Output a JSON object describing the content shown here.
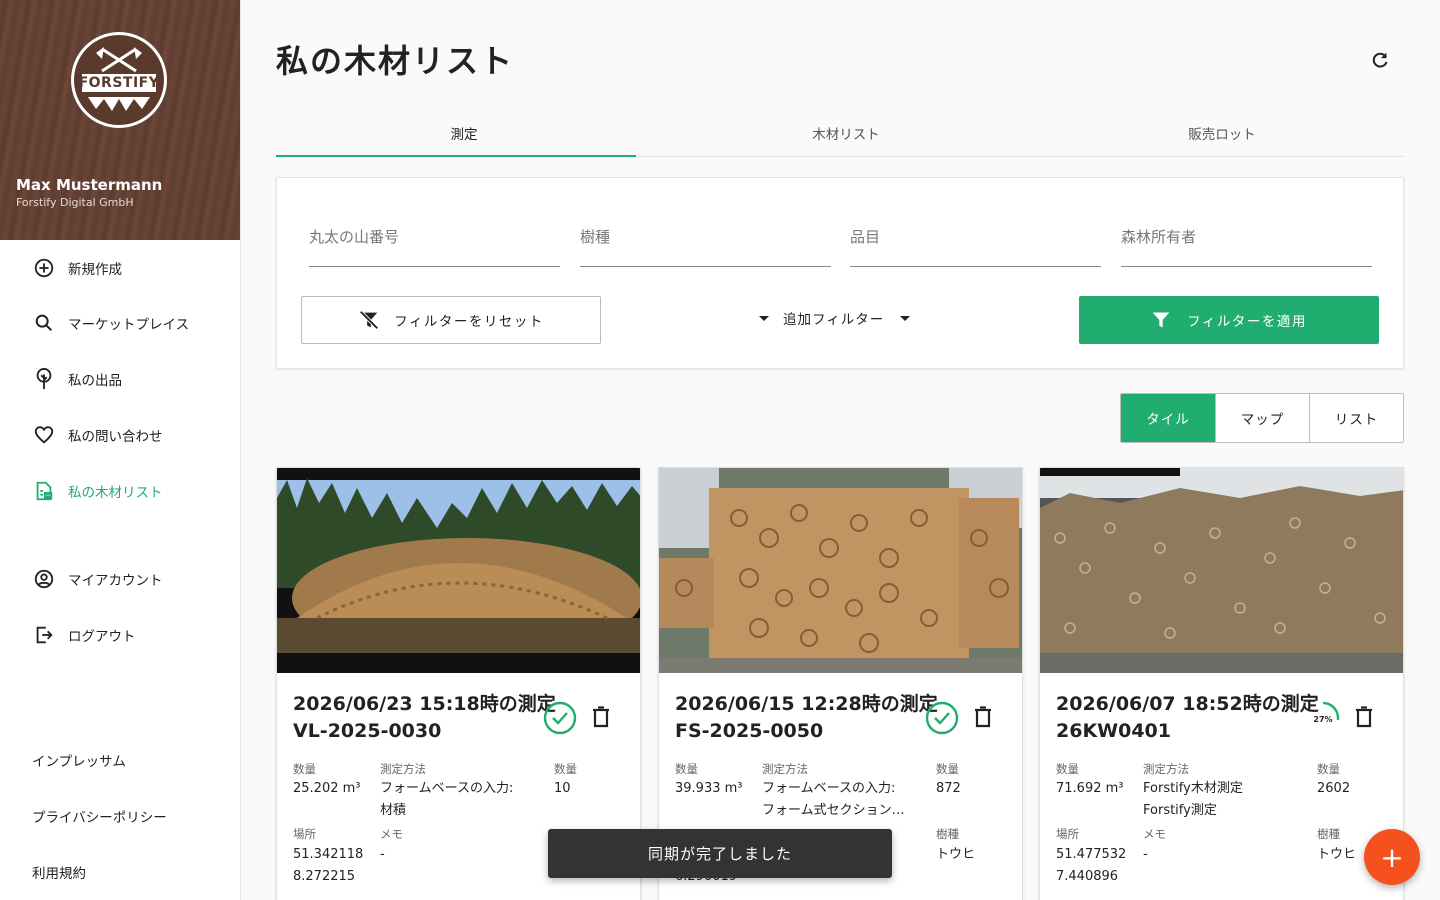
{
  "sidebar": {
    "brand": "FORSTIFY",
    "user_name": "Max Mustermann",
    "user_org": "Forstify Digital GmbH",
    "items": [
      {
        "label": "新規作成",
        "icon": "plus-circle-icon"
      },
      {
        "label": "マーケットプレイス",
        "icon": "search-icon"
      },
      {
        "label": "私の出品",
        "icon": "tree-icon"
      },
      {
        "label": "私の問い合わせ",
        "icon": "heart-icon"
      },
      {
        "label": "私の木材リスト",
        "icon": "document-list-icon"
      },
      {
        "label": "マイアカウント",
        "icon": "account-circle-icon"
      },
      {
        "label": "ログアウト",
        "icon": "logout-icon"
      }
    ],
    "footer": [
      "インプレッサム",
      "プライバシーポリシー",
      "利用規約"
    ]
  },
  "colors": {
    "accent": "#21ad6f",
    "fab": "#f4511e",
    "sidebar_header": "#5b3a2e"
  },
  "header": {
    "title": "私の木材リスト"
  },
  "tabs": [
    "測定",
    "木材リスト",
    "販売ロット"
  ],
  "filters": {
    "fields": [
      {
        "placeholder": "丸太の山番号",
        "value": ""
      },
      {
        "placeholder": "樹種",
        "value": ""
      },
      {
        "placeholder": "品目",
        "value": ""
      },
      {
        "placeholder": "森林所有者",
        "value": ""
      }
    ],
    "reset_label": "フィルターをリセット",
    "more_label": "追加フィルター",
    "apply_label": "フィルターを適用"
  },
  "view_toggle": [
    "タイル",
    "マップ",
    "リスト"
  ],
  "labels": {
    "quantity": "数量",
    "method": "測定方法",
    "count": "数量",
    "location": "場所",
    "memo": "メモ",
    "species": "樹種"
  },
  "cards": [
    {
      "title": "2026/06/23 15:18時の測定",
      "subtitle": "VL-2025-0030",
      "status": "done",
      "volume": "25.202 m³",
      "method_1": "フォームベースの入力:",
      "method_2": "材積",
      "count": "10",
      "lat": "51.342118",
      "lon": "8.272215",
      "memo": "-",
      "species": ""
    },
    {
      "title": "2026/06/15 12:28時の測定",
      "subtitle": "FS-2025-0050",
      "status": "done",
      "volume": "39.933 m³",
      "method_1": "フォームベースの入力:",
      "method_2": "フォーム式セクション…",
      "count": "872",
      "lat": "",
      "lon": "6.290019",
      "memo": "",
      "species": "トウヒ"
    },
    {
      "title": "2026/06/07 18:52時の測定",
      "subtitle": "26KW0401",
      "status": "progress",
      "progress_label": "27%",
      "progress": 0.27,
      "volume": "71.692 m³",
      "method_1": "Forstify木材測定",
      "method_2": "Forstify測定",
      "count": "2602",
      "lat": "51.477532",
      "lon": "7.440896",
      "memo": "-",
      "species": "トウヒ"
    }
  ],
  "toast": "同期が完了しました",
  "fab_label": "+"
}
